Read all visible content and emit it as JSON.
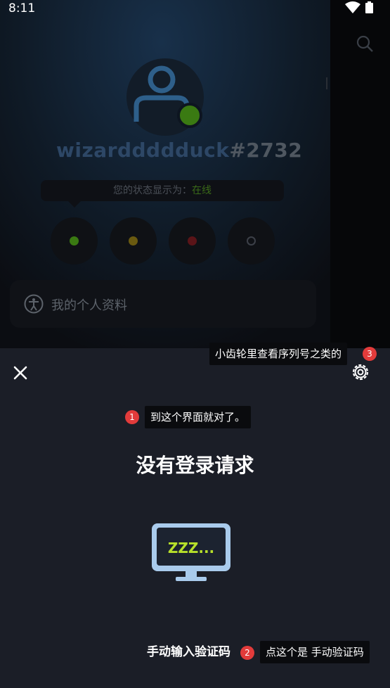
{
  "status_bar": {
    "time": "8:11"
  },
  "profile": {
    "username": "wizarddddduck",
    "discriminator": "#2732",
    "status_prefix": "您的状态显示为：",
    "status_value": "在线",
    "profile_label": "我的个人资料",
    "status_options": [
      {
        "name": "online",
        "color": "#3a7a12"
      },
      {
        "name": "idle",
        "color": "#6a5a10"
      },
      {
        "name": "dnd",
        "color": "#5a1418"
      },
      {
        "name": "invisible",
        "color": "#3c4048"
      }
    ],
    "avatar_color": "#2e5f8a",
    "presence_color": "#3a7a12"
  },
  "sheet": {
    "title": "没有登录请求",
    "monitor_text": "ZZZ...",
    "manual_entry": "手动输入验证码"
  },
  "annotations": [
    {
      "number": "1",
      "text": "到这个界面就对了。"
    },
    {
      "number": "2",
      "text": "点这个是 手动验证码"
    },
    {
      "number": "3",
      "text": "小齿轮里查看序列号之类的"
    }
  ],
  "icons": [
    "wifi-icon",
    "battery-icon",
    "search-icon",
    "avatar-icon",
    "accessibility-icon",
    "close-icon",
    "gear-icon",
    "monitor-icon"
  ]
}
